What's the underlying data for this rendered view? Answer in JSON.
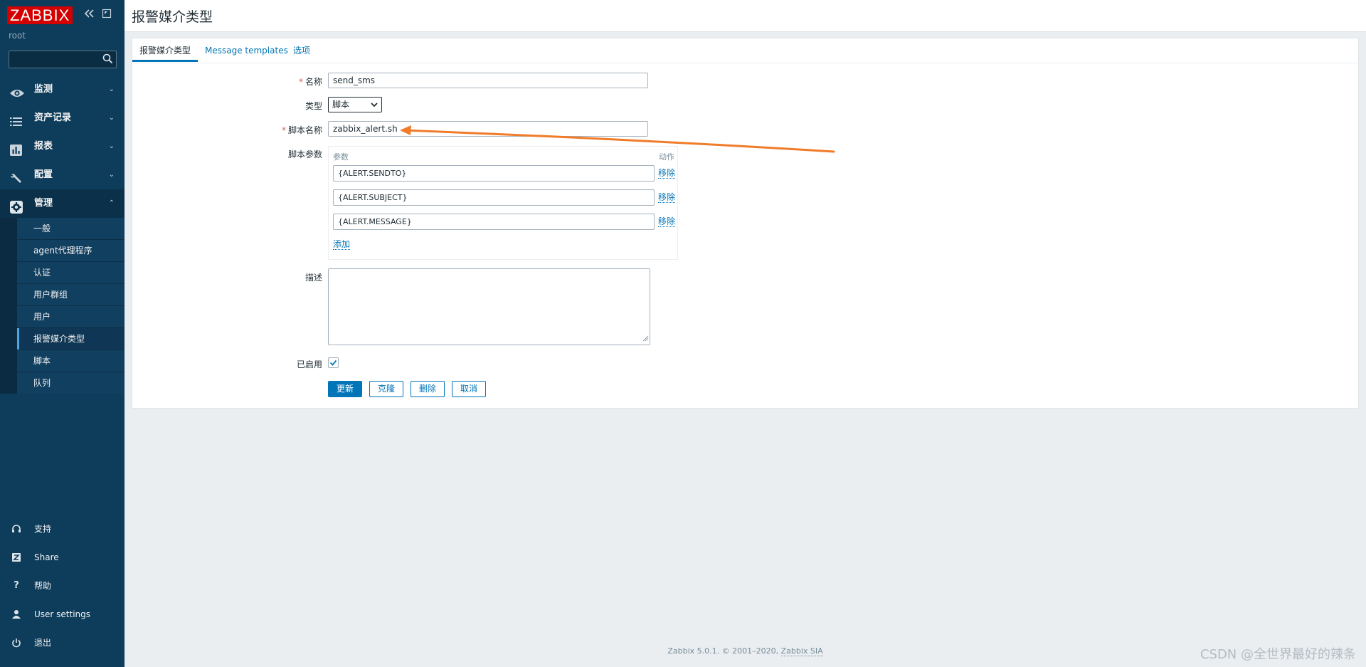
{
  "sidebar": {
    "logo": "ZABBIX",
    "user": "root",
    "search": {
      "value": "",
      "placeholder": ""
    },
    "nav": [
      {
        "label": "监测",
        "icon": "eye-icon"
      },
      {
        "label": "资产记录",
        "icon": "list-icon"
      },
      {
        "label": "报表",
        "icon": "bar-chart-icon"
      },
      {
        "label": "配置",
        "icon": "wrench-icon"
      },
      {
        "label": "管理",
        "icon": "gear-icon"
      }
    ],
    "admin_submenu": [
      {
        "label": "一般"
      },
      {
        "label": "agent代理程序"
      },
      {
        "label": "认证"
      },
      {
        "label": "用户群组"
      },
      {
        "label": "用户"
      },
      {
        "label": "报警媒介类型"
      },
      {
        "label": "脚本"
      },
      {
        "label": "队列"
      }
    ],
    "bottom": [
      {
        "label": "支持",
        "icon": "headset-icon"
      },
      {
        "label": "Share",
        "icon": "share-z-icon"
      },
      {
        "label": "帮助",
        "icon": "question-icon"
      },
      {
        "label": "User settings",
        "icon": "user-icon"
      },
      {
        "label": "退出",
        "icon": "power-icon"
      }
    ]
  },
  "header": {
    "title": "报警媒介类型"
  },
  "tabs": [
    {
      "label": "报警媒介类型"
    },
    {
      "label": "Message templates"
    },
    {
      "label": "选项"
    }
  ],
  "form": {
    "name_label": "名称",
    "name_value": "send_sms",
    "type_label": "类型",
    "type_value": "脚本",
    "script_name_label": "脚本名称",
    "script_name_value": "zabbix_alert.sh",
    "script_params_label": "脚本参数",
    "params_header": "参数",
    "action_header": "动作",
    "params": [
      {
        "value": "{ALERT.SENDTO}",
        "remove": "移除"
      },
      {
        "value": "{ALERT.SUBJECT}",
        "remove": "移除"
      },
      {
        "value": "{ALERT.MESSAGE}",
        "remove": "移除"
      }
    ],
    "add_label": "添加",
    "description_label": "描述",
    "description_value": "",
    "enabled_label": "已启用",
    "enabled": true
  },
  "buttons": {
    "update": "更新",
    "clone": "克隆",
    "delete": "删除",
    "cancel": "取消"
  },
  "footer": {
    "text": "Zabbix 5.0.1. © 2001–2020, ",
    "link": "Zabbix SIA"
  },
  "watermark": "CSDN @全世界最好的辣条",
  "colors": {
    "sidebar_bg": "#0e3d5b",
    "accent": "#0275b8",
    "logo_red": "#d40000",
    "arrow": "#f07c2a"
  }
}
